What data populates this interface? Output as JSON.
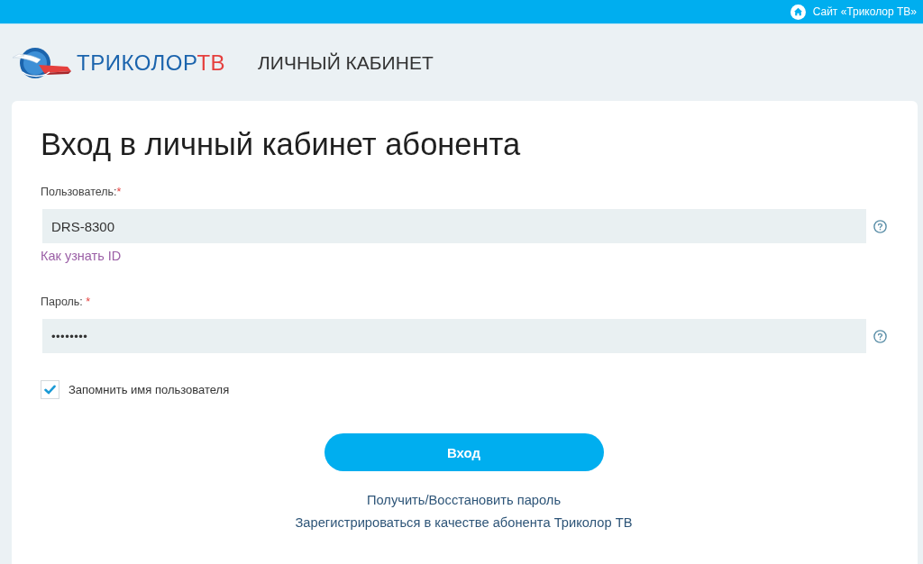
{
  "top_bar": {
    "site_link": "Сайт «Триколор ТВ»"
  },
  "header": {
    "logo": {
      "name": "ТРИКОЛОР",
      "accent": "ТВ"
    },
    "section_title": "ЛИЧНЫЙ КАБИНЕТ"
  },
  "login_form": {
    "title": "Вход в личный кабинет абонента",
    "fields": [
      {
        "kind": "text",
        "label": "Пользователь:",
        "required_mark": "*",
        "value": "DRS-8300",
        "help_link": "Как узнать ID"
      },
      {
        "kind": "password",
        "label": "Пароль: ",
        "required_mark": "*",
        "value": "••••••••"
      }
    ],
    "remember": {
      "label": "Запомнить имя пользователя",
      "checked": true
    },
    "submit_button": "Вход",
    "links": [
      "Получить/Восстановить пароль",
      "Зарегистрироваться в качестве абонента Триколор ТВ"
    ]
  }
}
